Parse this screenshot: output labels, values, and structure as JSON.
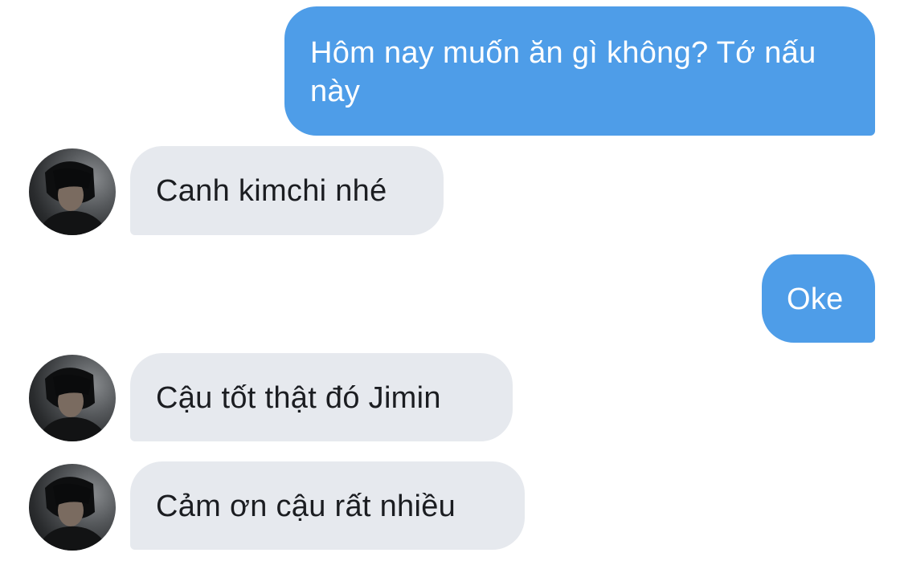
{
  "chat": {
    "messages": [
      {
        "sender": "me",
        "text": "Hôm nay muốn ăn gì không? Tớ nấu này"
      },
      {
        "sender": "contact",
        "text": "Canh kimchi nhé"
      },
      {
        "sender": "me",
        "text": "Oke"
      },
      {
        "sender": "contact",
        "text": "Cậu tốt thật đó Jimin"
      },
      {
        "sender": "contact",
        "text": "Cảm ơn cậu rất nhiều"
      }
    ]
  },
  "colors": {
    "sent_bubble": "#4e9de8",
    "received_bubble": "#e6e9ee",
    "sent_text": "#ffffff",
    "received_text": "#1b1d21"
  },
  "icons": {
    "contact_avatar": "profile-photo"
  }
}
